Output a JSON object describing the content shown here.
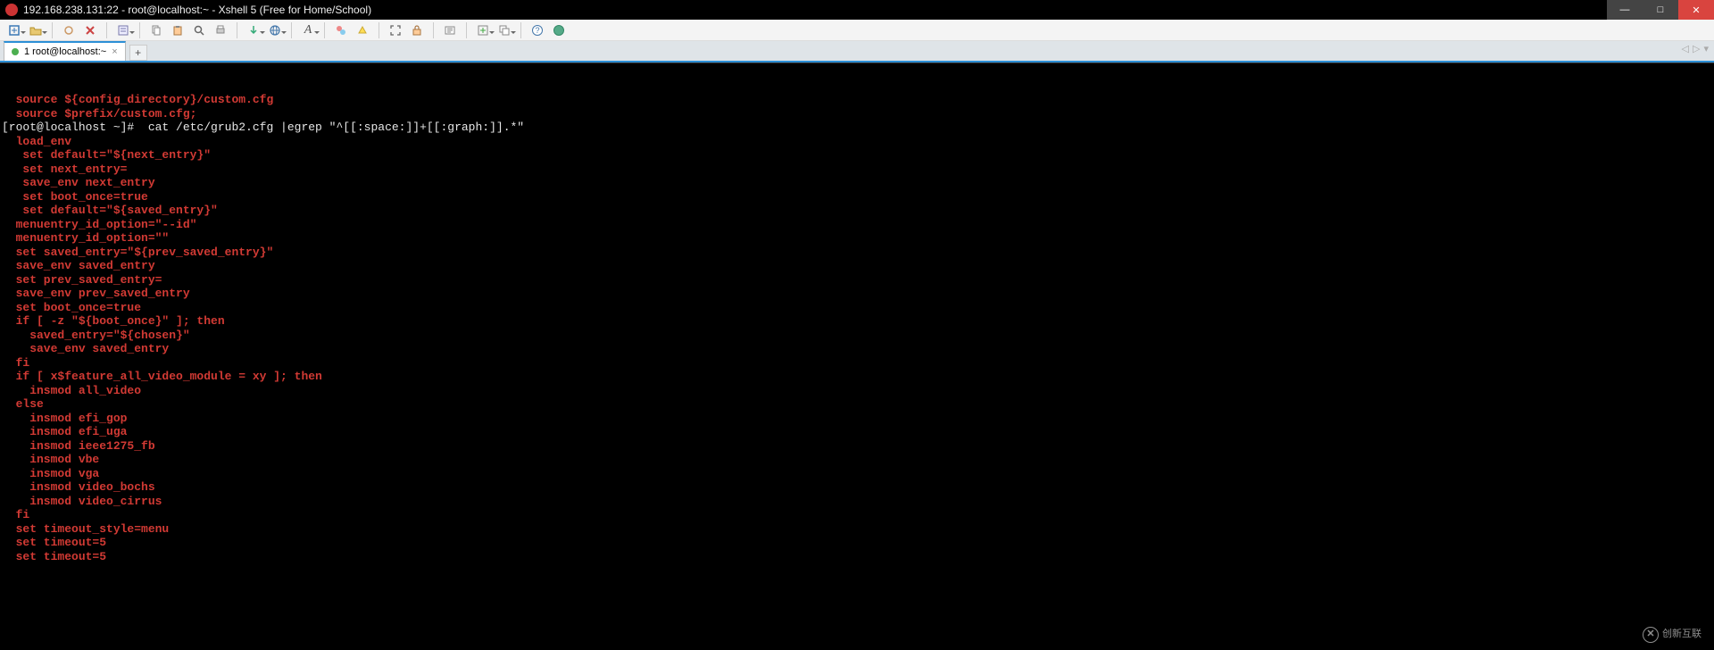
{
  "window": {
    "title": "192.168.238.131:22 - root@localhost:~ - Xshell 5 (Free for Home/School)",
    "controls": {
      "min": "—",
      "max": "□",
      "close": "✕"
    }
  },
  "toolbar": {
    "new": "new-session-icon",
    "open": "open-folder-icon",
    "reconnect": "reconnect-icon",
    "disconnect": "disconnect-icon",
    "properties": "properties-icon",
    "copy": "copy-icon",
    "paste": "paste-icon",
    "find": "search-icon",
    "print": "print-icon",
    "transfer": "file-transfer-icon",
    "globe": "web-icon",
    "font": "font-icon",
    "color": "color-scheme-icon",
    "highlight": "highlight-icon",
    "fullscreen": "fullscreen-icon",
    "lock": "lock-icon",
    "ruler": "ruler-icon",
    "add": "add-icon",
    "cascade": "cascade-icon",
    "help": "help-icon",
    "about": "about-icon"
  },
  "tab": {
    "label": "1 root@localhost:~",
    "add": "+",
    "nav_left": "◁",
    "nav_right": "▷",
    "nav_menu": "▾"
  },
  "terminal": {
    "lines": [
      "r|  source ${config_directory}/custom.cfg",
      "r|  source $prefix/custom.cfg;",
      "p|[root@localhost ~]#  cat /etc/grub2.cfg |egrep \"^[[:space:]]+[[:graph:]].*\"",
      "r|  load_env",
      "r|   set default=\"${next_entry}\"",
      "r|   set next_entry=",
      "r|   save_env next_entry",
      "r|   set boot_once=true",
      "r|   set default=\"${saved_entry}\"",
      "r|  menuentry_id_option=\"--id\"",
      "r|  menuentry_id_option=\"\"",
      "r|  set saved_entry=\"${prev_saved_entry}\"",
      "r|  save_env saved_entry",
      "r|  set prev_saved_entry=",
      "r|  save_env prev_saved_entry",
      "r|  set boot_once=true",
      "r|  if [ -z \"${boot_once}\" ]; then",
      "r|    saved_entry=\"${chosen}\"",
      "r|    save_env saved_entry",
      "r|  fi",
      "r|  if [ x$feature_all_video_module = xy ]; then",
      "r|    insmod all_video",
      "r|  else",
      "r|    insmod efi_gop",
      "r|    insmod efi_uga",
      "r|    insmod ieee1275_fb",
      "r|    insmod vbe",
      "r|    insmod vga",
      "r|    insmod video_bochs",
      "r|    insmod video_cirrus",
      "r|  fi",
      "r|  set timeout_style=menu",
      "r|  set timeout=5",
      "r|  set timeout=5"
    ]
  },
  "watermark": {
    "text": "创新互联"
  }
}
